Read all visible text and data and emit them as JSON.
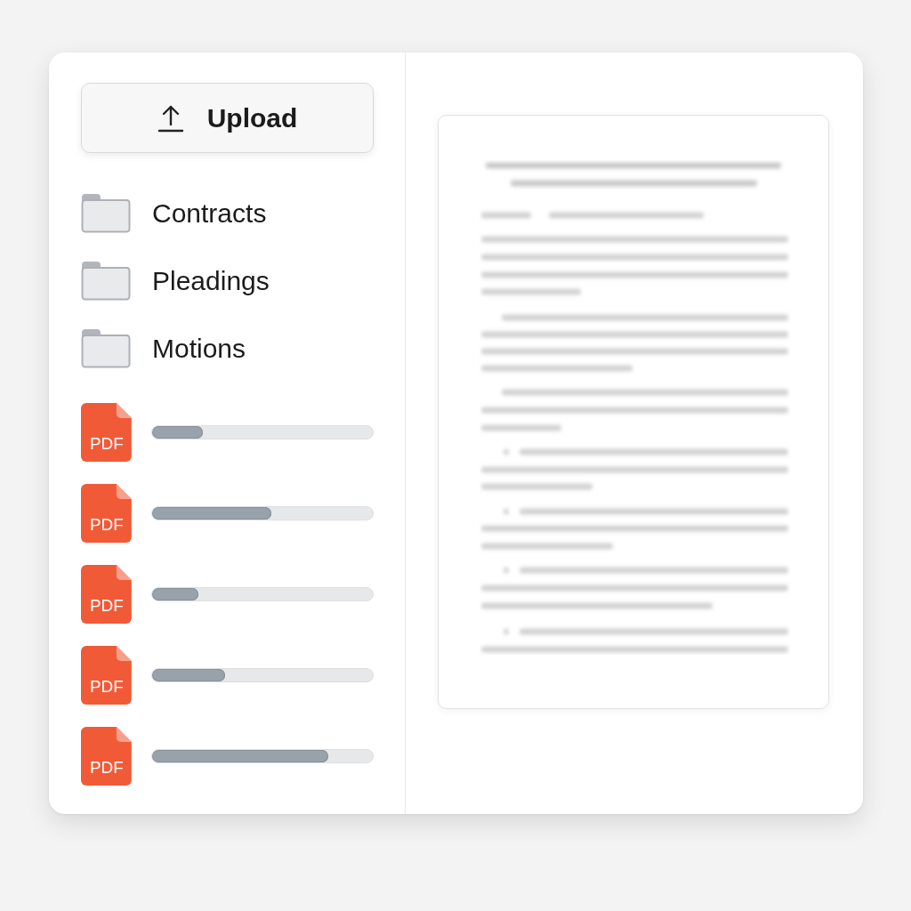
{
  "upload_button": {
    "label": "Upload"
  },
  "folders": [
    {
      "name": "Contracts"
    },
    {
      "name": "Pleadings"
    },
    {
      "name": "Motions"
    }
  ],
  "uploads": [
    {
      "file_type": "PDF",
      "level": 0.23
    },
    {
      "file_type": "PDF",
      "level": 0.54
    },
    {
      "file_type": "PDF",
      "level": 0.21
    },
    {
      "file_type": "PDF",
      "level": 0.33
    },
    {
      "file_type": "PDF",
      "level": 0.8
    }
  ],
  "document_preview": {
    "kind": "blurred_page"
  }
}
